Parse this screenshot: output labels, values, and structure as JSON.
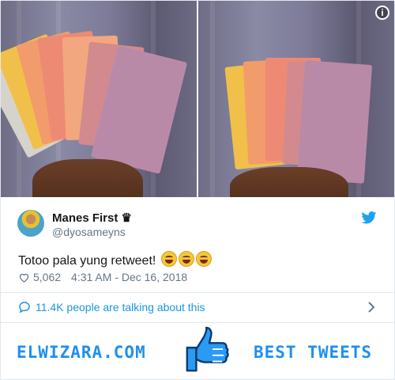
{
  "tweet": {
    "author_name": "Manes First ♛",
    "author_handle": "@dyosameyns",
    "text": "Totoo pala yung retweet!",
    "emojis": [
      "face-with-tears-of-joy",
      "face-with-tears-of-joy",
      "face-with-tears-of-joy"
    ],
    "likes": "5,062",
    "timestamp": "4:31 AM - Dec 16, 2018",
    "talking": "11.4K people are talking about this"
  },
  "media": {
    "photos": [
      "photo-1",
      "photo-2"
    ],
    "info_icon": "i"
  },
  "banner": {
    "left_text": "ELWIZARA.COM",
    "right_text": "BEST TWEETS",
    "icon": "thumbs-up-icon"
  },
  "colors": {
    "accent": "#1b95e0",
    "banner_blue": "#1f8ff0",
    "muted": "#657786",
    "border": "#e1e8ed"
  }
}
